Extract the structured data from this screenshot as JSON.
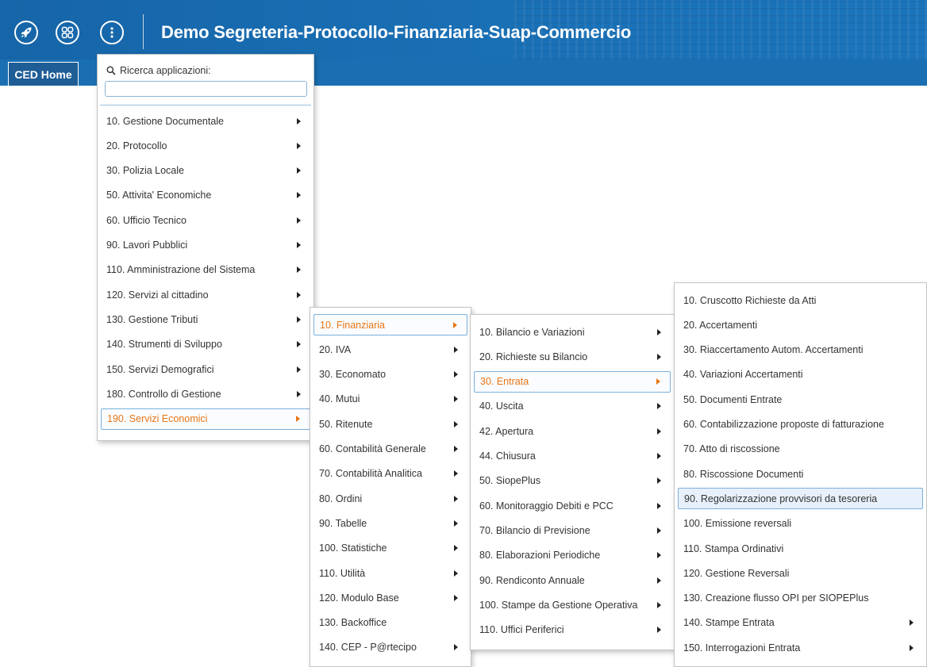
{
  "header": {
    "title": "Demo Segreteria-Protocollo-Finanziaria-Suap-Commercio",
    "icons": [
      "rocket-icon",
      "apps-grid-icon",
      "more-options-icon"
    ]
  },
  "tabs": {
    "home": "CED Home"
  },
  "colors": {
    "header_blue": "#1a6fb3",
    "active_text": "#e87514",
    "highlight_border": "#7ab0db"
  },
  "search": {
    "label": "Ricerca applicazioni:",
    "value": ""
  },
  "menu_level1": [
    "10. Gestione Documentale",
    "20. Protocollo",
    "30. Polizia Locale",
    "50. Attivita' Economiche",
    "60. Ufficio Tecnico",
    "90. Lavori Pubblici",
    "110. Amministrazione del Sistema",
    "120. Servizi al cittadino",
    "130. Gestione Tributi",
    "140. Strumenti di Sviluppo",
    "150. Servizi Demografici",
    "180. Controllo di Gestione",
    "190. Servizi Economici"
  ],
  "menu_level2": [
    "10. Finanziaria",
    "20. IVA",
    "30. Economato",
    "40. Mutui",
    "50. Ritenute",
    "60. Contabilità Generale",
    "70. Contabilità Analitica",
    "80. Ordini",
    "90. Tabelle",
    "100. Statistiche",
    "110. Utilità",
    "120. Modulo Base",
    "130. Backoffice",
    "140. CEP - P@rtecipo"
  ],
  "menu_level3": [
    "10. Bilancio e Variazioni",
    "20. Richieste su Bilancio",
    "30. Entrata",
    "40. Uscita",
    "42. Apertura",
    "44. Chiusura",
    "50. SiopePlus",
    "60. Monitoraggio Debiti e PCC",
    "70. Bilancio di Previsione",
    "80. Elaborazioni Periodiche",
    "90. Rendiconto Annuale",
    "100. Stampe da Gestione Operativa",
    "110. Uffici Periferici"
  ],
  "menu_level4": [
    "10. Cruscotto Richieste da Atti",
    "20. Accertamenti",
    "30. Riaccertamento Autom. Accertamenti",
    "40. Variazioni Accertamenti",
    "50. Documenti Entrate",
    "60. Contabilizzazione proposte di fatturazione",
    "70. Atto di riscossione",
    "80. Riscossione Documenti",
    "90. Regolarizzazione provvisori da tesoreria",
    "100. Emissione reversali",
    "110. Stampa Ordinativi",
    "120. Gestione Reversali",
    "130. Creazione flusso OPI per SIOPEPlus",
    "140. Stampe Entrata",
    "150. Interrogazioni Entrata"
  ]
}
